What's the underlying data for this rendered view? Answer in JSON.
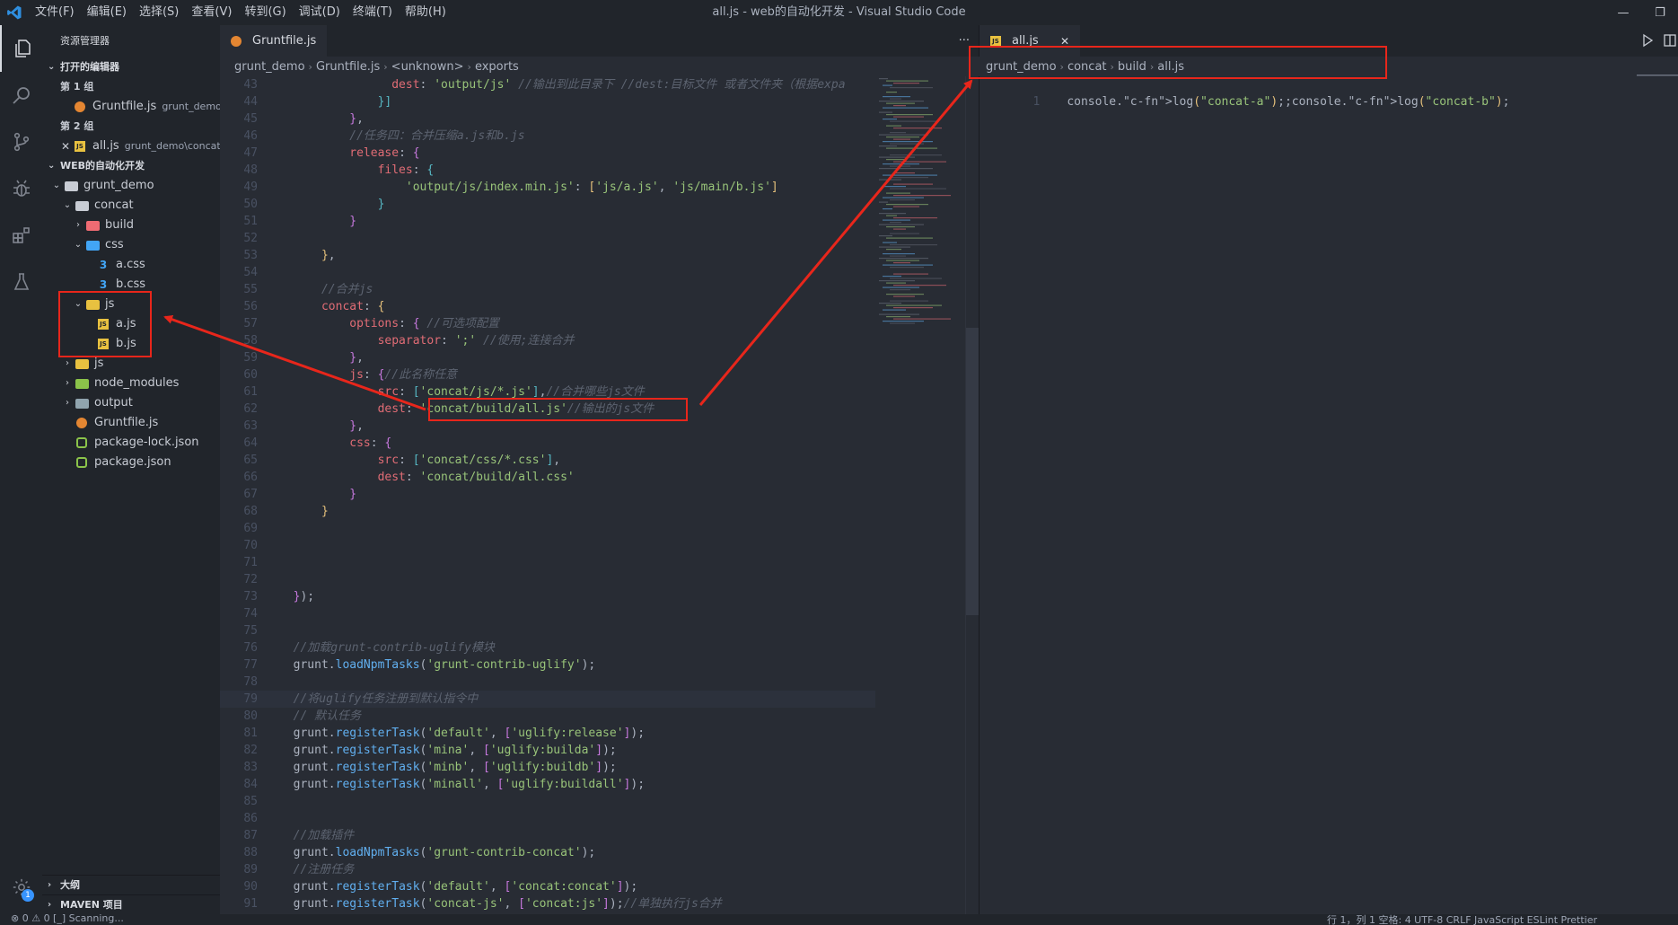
{
  "window": {
    "title": "all.js - web的自动化开发 - Visual Studio Code",
    "menu": [
      "文件(F)",
      "编辑(E)",
      "选择(S)",
      "查看(V)",
      "转到(G)",
      "调试(D)",
      "终端(T)",
      "帮助(H)"
    ]
  },
  "sidebar": {
    "title": "资源管理器",
    "open_editors_label": "打开的编辑器",
    "group1_label": "第 1 组",
    "group1_file": "Gruntfile.js",
    "group1_file_desc": "grunt_demo",
    "group2_label": "第 2 组",
    "group2_file": "all.js",
    "group2_file_desc": "grunt_demo\\concat...",
    "workspace_label": "WEB的自动化开发",
    "tree": [
      {
        "label": "grunt_demo",
        "depth": 0,
        "chev": "open",
        "icon": "folder-open"
      },
      {
        "label": "concat",
        "depth": 1,
        "chev": "open",
        "icon": "folder-open"
      },
      {
        "label": "build",
        "depth": 2,
        "chev": "closed",
        "icon": "folder-red"
      },
      {
        "label": "css",
        "depth": 2,
        "chev": "open",
        "icon": "folder-blue"
      },
      {
        "label": "a.css",
        "depth": 3,
        "chev": "none",
        "icon": "css"
      },
      {
        "label": "b.css",
        "depth": 3,
        "chev": "none",
        "icon": "css"
      },
      {
        "label": "js",
        "depth": 2,
        "chev": "open",
        "icon": "folder-yellow"
      },
      {
        "label": "a.js",
        "depth": 3,
        "chev": "none",
        "icon": "js"
      },
      {
        "label": "b.js",
        "depth": 3,
        "chev": "none",
        "icon": "js"
      },
      {
        "label": "js",
        "depth": 1,
        "chev": "closed",
        "icon": "folder-yellow"
      },
      {
        "label": "node_modules",
        "depth": 1,
        "chev": "closed",
        "icon": "folder-green"
      },
      {
        "label": "output",
        "depth": 1,
        "chev": "closed",
        "icon": "folder-plain"
      },
      {
        "label": "Gruntfile.js",
        "depth": 1,
        "chev": "none",
        "icon": "grunt"
      },
      {
        "label": "package-lock.json",
        "depth": 1,
        "chev": "none",
        "icon": "json"
      },
      {
        "label": "package.json",
        "depth": 1,
        "chev": "none",
        "icon": "json"
      }
    ],
    "outline_label": "大纲",
    "maven_label": "MAVEN 项目"
  },
  "activity": {
    "badge": "1"
  },
  "editor1": {
    "tab_label": "Gruntfile.js",
    "more": "···",
    "breadcrumb": [
      "grunt_demo",
      "Gruntfile.js",
      "<unknown>",
      "exports"
    ]
  },
  "editor2": {
    "tab_label": "all.js",
    "breadcrumb": [
      "grunt_demo",
      "concat",
      "build",
      "all.js"
    ],
    "line_number": "1"
  },
  "code_lines": [
    {
      "n": "43",
      "html": "                <span class=\"c-prop\">dest</span>: <span class=\"c-str\">'output/js'</span> <span class=\"c-com\">//输出到此目录下 //dest:目标文件 或者文件夹（根据expa</span>"
    },
    {
      "n": "44",
      "html": "              <span class=\"c-br3\">}]</span>"
    },
    {
      "n": "45",
      "html": "          <span class=\"c-br\">}</span>,"
    },
    {
      "n": "46",
      "html": "          <span class=\"c-com\">//任务四：合并压缩a.js和b.js</span>"
    },
    {
      "n": "47",
      "html": "          <span class=\"c-prop\">release</span>: <span class=\"c-br\">{</span>"
    },
    {
      "n": "48",
      "html": "              <span class=\"c-prop\">files</span>: <span class=\"c-br3\">{</span>"
    },
    {
      "n": "49",
      "html": "                  <span class=\"c-str\">'output/js/index.min.js'</span>: <span class=\"c-br2\">[</span><span class=\"c-str\">'js/a.js'</span>, <span class=\"c-str\">'js/main/b.js'</span><span class=\"c-br2\">]</span>"
    },
    {
      "n": "50",
      "html": "              <span class=\"c-br3\">}</span>"
    },
    {
      "n": "51",
      "html": "          <span class=\"c-br\">}</span>"
    },
    {
      "n": "52",
      "html": ""
    },
    {
      "n": "53",
      "html": "      <span class=\"c-br2\">}</span>,"
    },
    {
      "n": "54",
      "html": ""
    },
    {
      "n": "55",
      "html": "      <span class=\"c-com\">//合并js</span>"
    },
    {
      "n": "56",
      "html": "      <span class=\"c-prop\">concat</span>: <span class=\"c-br2\">{</span>"
    },
    {
      "n": "57",
      "html": "          <span class=\"c-prop\">options</span>: <span class=\"c-br\">{</span> <span class=\"c-com\">//可选项配置</span>"
    },
    {
      "n": "58",
      "html": "              <span class=\"c-prop\">separator</span>: <span class=\"c-str\">';'</span> <span class=\"c-com\">//使用;连接合并</span>"
    },
    {
      "n": "59",
      "html": "          <span class=\"c-br\">}</span>,"
    },
    {
      "n": "60",
      "html": "          <span class=\"c-prop\">js</span>: <span class=\"c-br\">{</span><span class=\"c-com\">//此名称任意</span>"
    },
    {
      "n": "61",
      "html": "              <span class=\"c-prop\">src</span>: <span class=\"c-br3\">[</span><span class=\"c-str\">'concat/js/*.js'</span><span class=\"c-br3\">]</span>,<span class=\"c-com\">//合并哪些js文件</span>"
    },
    {
      "n": "62",
      "html": "              <span class=\"c-prop\">dest</span>: <span class=\"c-str\">'concat/build/all.js'</span><span class=\"c-com\">//输出的js文件</span>"
    },
    {
      "n": "63",
      "html": "          <span class=\"c-br\">}</span>,"
    },
    {
      "n": "64",
      "html": "          <span class=\"c-prop\">css</span>: <span class=\"c-br\">{</span>"
    },
    {
      "n": "65",
      "html": "              <span class=\"c-prop\">src</span>: <span class=\"c-br3\">[</span><span class=\"c-str\">'concat/css/*.css'</span><span class=\"c-br3\">]</span>,"
    },
    {
      "n": "66",
      "html": "              <span class=\"c-prop\">dest</span>: <span class=\"c-str\">'concat/build/all.css'</span>"
    },
    {
      "n": "67",
      "html": "          <span class=\"c-br\">}</span>"
    },
    {
      "n": "68",
      "html": "      <span class=\"c-br2\">}</span>"
    },
    {
      "n": "69",
      "html": ""
    },
    {
      "n": "70",
      "html": ""
    },
    {
      "n": "71",
      "html": ""
    },
    {
      "n": "72",
      "html": ""
    },
    {
      "n": "73",
      "html": "  <span class=\"c-br\">}</span>);"
    },
    {
      "n": "74",
      "html": ""
    },
    {
      "n": "75",
      "html": ""
    },
    {
      "n": "76",
      "html": "  <span class=\"c-com\">//加载grunt-contrib-uglify模块</span>"
    },
    {
      "n": "77",
      "html": "  grunt.<span class=\"c-fn\">loadNpmTasks</span>(<span class=\"c-str\">'grunt-contrib-uglify'</span>);"
    },
    {
      "n": "78",
      "html": ""
    },
    {
      "n": "79",
      "html": "  <span class=\"c-com\">//将uglify任务注册到默认指令中</span>",
      "cur": true
    },
    {
      "n": "80",
      "html": "  <span class=\"c-com\">// 默认任务</span>"
    },
    {
      "n": "81",
      "html": "  grunt.<span class=\"c-fn\">registerTask</span>(<span class=\"c-str\">'default'</span>, <span class=\"c-br\">[</span><span class=\"c-str\">'uglify:release'</span><span class=\"c-br\">]</span>);"
    },
    {
      "n": "82",
      "html": "  grunt.<span class=\"c-fn\">registerTask</span>(<span class=\"c-str\">'mina'</span>, <span class=\"c-br\">[</span><span class=\"c-str\">'uglify:builda'</span><span class=\"c-br\">]</span>);"
    },
    {
      "n": "83",
      "html": "  grunt.<span class=\"c-fn\">registerTask</span>(<span class=\"c-str\">'minb'</span>, <span class=\"c-br\">[</span><span class=\"c-str\">'uglify:buildb'</span><span class=\"c-br\">]</span>);"
    },
    {
      "n": "84",
      "html": "  grunt.<span class=\"c-fn\">registerTask</span>(<span class=\"c-str\">'minall'</span>, <span class=\"c-br\">[</span><span class=\"c-str\">'uglify:buildall'</span><span class=\"c-br\">]</span>);"
    },
    {
      "n": "85",
      "html": ""
    },
    {
      "n": "86",
      "html": ""
    },
    {
      "n": "87",
      "html": "  <span class=\"c-com\">//加载插件</span>"
    },
    {
      "n": "88",
      "html": "  grunt.<span class=\"c-fn\">loadNpmTasks</span>(<span class=\"c-str\">'grunt-contrib-concat'</span>);"
    },
    {
      "n": "89",
      "html": "  <span class=\"c-com\">//注册任务</span>"
    },
    {
      "n": "90",
      "html": "  grunt.<span class=\"c-fn\">registerTask</span>(<span class=\"c-str\">'default'</span>, <span class=\"c-br\">[</span><span class=\"c-str\">'concat:concat'</span><span class=\"c-br\">]</span>);"
    },
    {
      "n": "91",
      "html": "  grunt.<span class=\"c-fn\">registerTask</span>(<span class=\"c-str\">'concat-js'</span>, <span class=\"c-br\">[</span><span class=\"c-str\">'concat:js'</span><span class=\"c-br\">]</span>);<span class=\"c-com\">//单独执行js合并</span>"
    }
  ],
  "all_js_line": "console.log(\"concat-a\");;console.log(\"concat-b\");",
  "statusbar": {
    "left": "⊗ 0 ⚠ 0   [_] Scanning...",
    "right": "行 1，列 1   空格: 4   UTF-8   CRLF   JavaScript   ESLint   Prettier"
  },
  "colors": {
    "annotation": "#e8261b",
    "accent": "#2f8fe0"
  }
}
